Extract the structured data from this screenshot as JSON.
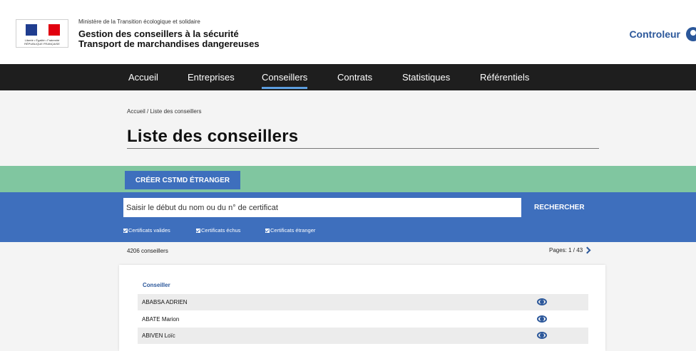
{
  "header": {
    "logo_text": "Liberté • Égalité • Fraternité RÉPUBLIQUE FRANÇAISE",
    "ministry": "Ministère de la Transition écologique et solidaire",
    "app_line1": "Gestion des conseillers à la sécurité",
    "app_line2": "Transport de marchandises dangereuses",
    "user_label": "Controleur",
    "user_icon": "user-circle-icon"
  },
  "nav": {
    "items": [
      {
        "label": "Accueil"
      },
      {
        "label": "Entreprises"
      },
      {
        "label": "Conseillers"
      },
      {
        "label": "Contrats"
      },
      {
        "label": "Statistiques"
      },
      {
        "label": "Référentiels"
      }
    ],
    "active": "Conseillers"
  },
  "breadcrumb": "Accueil / Liste des conseillers",
  "page_title": "Liste des conseillers",
  "actions": {
    "create_label": "CRÉER CSTMD ÉTRANGER"
  },
  "search": {
    "placeholder": "Saisir le début du nom ou du n° de certificat",
    "button_label": "RECHERCHER",
    "filters": [
      {
        "label": "Certificats valides",
        "checked": true
      },
      {
        "label": "Certificats échus",
        "checked": true
      },
      {
        "label": "Certificats étranger",
        "checked": true
      }
    ]
  },
  "results": {
    "count_label": "4206 conseillers",
    "pages_label": "Pages: 1 / 43"
  },
  "table": {
    "column_header": "Conseiller",
    "rows": [
      {
        "name": "ABABSA ADRIEN"
      },
      {
        "name": "ABATE Marion"
      },
      {
        "name": "ABIVEN Loïc"
      }
    ],
    "row_action_icon": "eye-icon"
  },
  "colors": {
    "nav_bg": "#1e1e1e",
    "accent_blue": "#3e6fbd",
    "green_band": "#80c6a0",
    "link_blue": "#2b579a"
  }
}
